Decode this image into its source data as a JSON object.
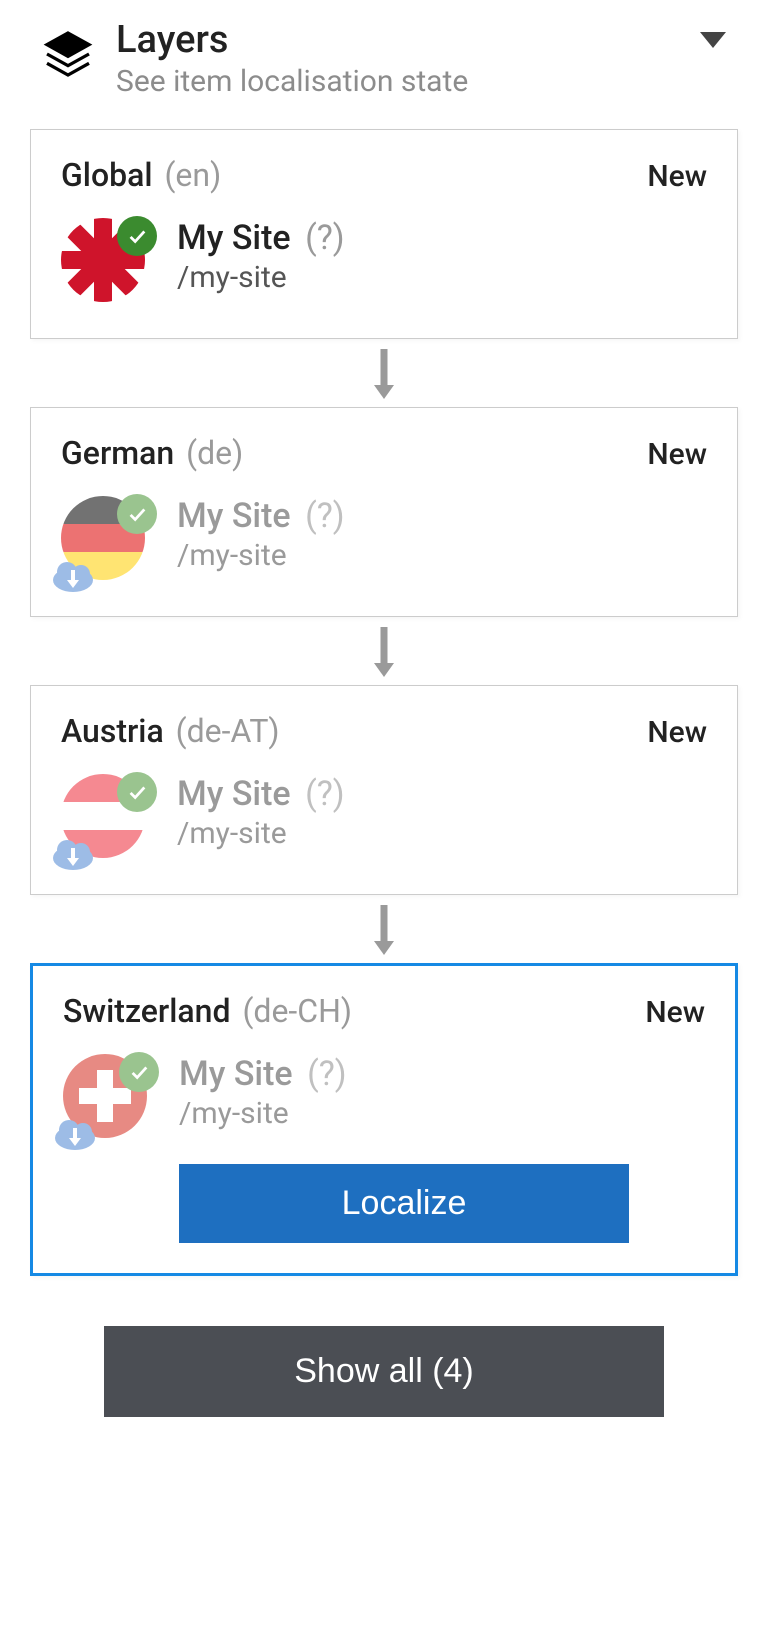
{
  "header": {
    "title": "Layers",
    "subtitle": "See item localisation state"
  },
  "cards": [
    {
      "title": "Global",
      "locale": "(en)",
      "status": "New",
      "site_name": "My Site",
      "site_q": "(?)",
      "site_path": "/my-site",
      "flag": "uk",
      "faded": false,
      "selected": false,
      "has_cloud": false,
      "action": null
    },
    {
      "title": "German",
      "locale": "(de)",
      "status": "New",
      "site_name": "My Site",
      "site_q": "(?)",
      "site_path": "/my-site",
      "flag": "de",
      "faded": true,
      "selected": false,
      "has_cloud": true,
      "action": null
    },
    {
      "title": "Austria",
      "locale": "(de-AT)",
      "status": "New",
      "site_name": "My Site",
      "site_q": "(?)",
      "site_path": "/my-site",
      "flag": "at",
      "faded": true,
      "selected": false,
      "has_cloud": true,
      "action": null
    },
    {
      "title": "Switzerland",
      "locale": "(de-CH)",
      "status": "New",
      "site_name": "My Site",
      "site_q": "(?)",
      "site_path": "/my-site",
      "flag": "ch",
      "faded": true,
      "selected": true,
      "has_cloud": true,
      "action": "Localize"
    }
  ],
  "footer": {
    "show_all_label": "Show all (4)"
  }
}
